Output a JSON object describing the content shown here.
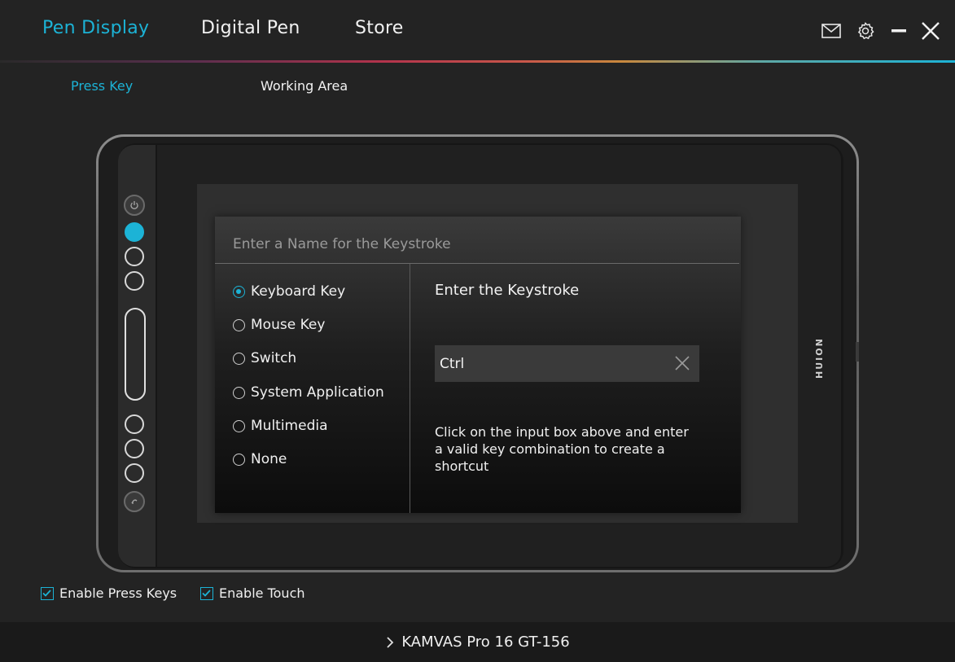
{
  "header": {
    "tabs": [
      {
        "label": "Pen Display",
        "active": true
      },
      {
        "label": "Digital Pen",
        "active": false
      },
      {
        "label": "Store",
        "active": false
      }
    ],
    "icons": [
      "mail-icon",
      "gear-icon",
      "minimize-icon",
      "close-icon"
    ]
  },
  "subtabs": [
    {
      "label": "Press Key",
      "active": true
    },
    {
      "label": "Working Area",
      "active": false
    }
  ],
  "device": {
    "brand": "HUION",
    "selected_key_index": 1
  },
  "dialog": {
    "name_placeholder": "Enter a Name for the Keystroke",
    "options": [
      {
        "label": "Keyboard Key",
        "checked": true
      },
      {
        "label": "Mouse Key",
        "checked": false
      },
      {
        "label": "Switch",
        "checked": false
      },
      {
        "label": "System Application",
        "checked": false
      },
      {
        "label": "Multimedia",
        "checked": false
      },
      {
        "label": "None",
        "checked": false
      }
    ],
    "keystroke_title": "Enter the Keystroke",
    "keystroke_value": "Ctrl",
    "hint": "Click on the input box above and enter a valid key combination to create a shortcut"
  },
  "options": {
    "enable_press_keys": {
      "label": "Enable Press Keys",
      "checked": true
    },
    "enable_touch": {
      "label": "Enable Touch",
      "checked": true
    }
  },
  "footer": {
    "device_name": "KAMVAS Pro 16 GT-156"
  },
  "colors": {
    "accent": "#1cb3d6",
    "background": "#232323",
    "footer": "#1a1a1a"
  }
}
